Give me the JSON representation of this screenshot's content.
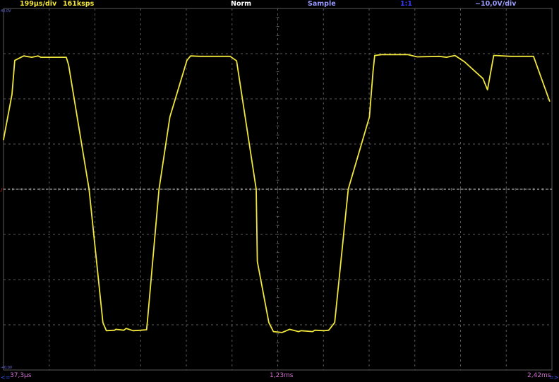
{
  "header": {
    "timebase": "199µs/div",
    "sample_rate": "161ksps",
    "trigger_mode": "Norm",
    "acquisition_mode": "Sample",
    "probe_ratio": "1:1",
    "volts_per_div": "~10,0V/div"
  },
  "scale_labels": {
    "top": "40,0V",
    "bottom": "-40,0V"
  },
  "footer": {
    "left_arrow": "<=",
    "time_start": "37,3µs",
    "time_center": "1,23ms",
    "time_end": "2,42ms",
    "right_arrow": "=>"
  },
  "colors": {
    "background": "#000000",
    "trace": "#f0e63c",
    "timebase_text": "#f0e63c",
    "mode_text": "#ffffff",
    "sample_text": "#9a9aff",
    "ratio_text": "#3a3aff",
    "scale_text": "#9a9aff",
    "time_text": "#d070d0",
    "arrow_text": "#3a5aff",
    "grid": "#5a5a5a",
    "ground_marker": "#ffffff",
    "trigger_marker": "#ff3030"
  },
  "chart_data": {
    "type": "line",
    "title": "",
    "xlabel": "",
    "ylabel": "",
    "x_unit": "ms",
    "y_unit": "V",
    "xlim": [
      0.0373,
      2.42
    ],
    "ylim": [
      -40,
      40
    ],
    "grid": true,
    "series": [
      {
        "x": [
          0.0373,
          0.074,
          0.086,
          0.125,
          0.16,
          0.187,
          0.199,
          0.225,
          0.245,
          0.27,
          0.31,
          0.32,
          0.409,
          0.469,
          0.484,
          0.52,
          0.525,
          0.56,
          0.57,
          0.6,
          0.633,
          0.659,
          0.663,
          0.713,
          0.76,
          0.834,
          0.85,
          0.89,
          0.935,
          0.965,
          0.997,
          1.022,
          1.05,
          1.135,
          1.14,
          1.19,
          1.21,
          1.247,
          1.28,
          1.319,
          1.33,
          1.38,
          1.39,
          1.43,
          1.45,
          1.476,
          1.535,
          1.627,
          1.643,
          1.65,
          1.68,
          1.765,
          1.775,
          1.793,
          1.834,
          1.931,
          1.962,
          1.999,
          2.04,
          2.12,
          2.14,
          2.167,
          2.177,
          2.24,
          2.34,
          2.41
        ],
        "y": [
          11,
          21,
          28.5,
          29.5,
          29.2,
          29.5,
          29.2,
          29.2,
          29.2,
          29.2,
          29.2,
          27.5,
          0,
          -29.5,
          -31.3,
          -31.2,
          -31.0,
          -31.2,
          -30.8,
          -31.3,
          -31.2,
          -31.1,
          -29.0,
          0,
          16,
          28.5,
          29.5,
          29.4,
          29.4,
          29.4,
          29.4,
          29.4,
          28.4,
          0,
          -16,
          -29.5,
          -31.5,
          -31.7,
          -31.0,
          -31.5,
          -31.3,
          -31.5,
          -31.2,
          -31.3,
          -31.2,
          -29.5,
          0,
          16,
          26.2,
          29.6,
          29.8,
          29.8,
          29.8,
          29.8,
          29.3,
          29.4,
          29.2,
          29.6,
          28.2,
          24.5,
          22,
          29.6,
          29.6,
          29.4,
          29.4,
          19.5
        ]
      }
    ]
  }
}
